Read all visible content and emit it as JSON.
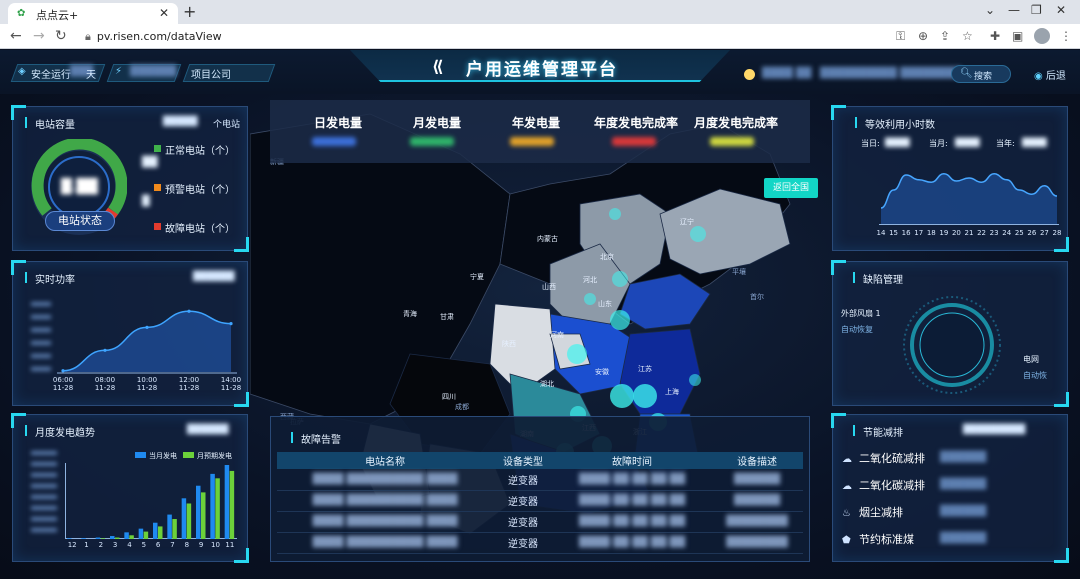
{
  "browser": {
    "tab_title": "点点云+",
    "url": "pv.risen.com/dataView"
  },
  "header": {
    "title": "户用运维管理平台",
    "safe_run_label": "安全运行",
    "safe_run_unit": "天",
    "project_label": "项目公司",
    "search_label": "搜索",
    "back_label": "后退"
  },
  "capacity": {
    "title": "电站容量",
    "unit": "个电站",
    "gauge_label": "电站状态",
    "statuses": [
      {
        "label": "正常电站（个）",
        "color": "#3fb24a"
      },
      {
        "label": "预警电站（个）",
        "color": "#f08a1c"
      },
      {
        "label": "故障电站（个）",
        "color": "#e23b2e"
      }
    ]
  },
  "realtime": {
    "title": "实时功率",
    "x_labels": [
      [
        "06:00",
        "11-28"
      ],
      [
        "08:00",
        "11-28"
      ],
      [
        "10:00",
        "11-28"
      ],
      [
        "12:00",
        "11-28"
      ],
      [
        "14:00",
        "11-28"
      ]
    ]
  },
  "monthly": {
    "title": "月度发电趋势",
    "legend": [
      {
        "label": "当月发电",
        "color": "#1f8af0"
      },
      {
        "label": "月预期发电",
        "color": "#6cd13a"
      }
    ]
  },
  "kpis": [
    "日发电量",
    "月发电量",
    "年发电量",
    "年度发电完成率",
    "月度发电完成率"
  ],
  "map": {
    "back_all_label": "返回全国",
    "provinces": [
      "内蒙古",
      "辽宁",
      "北京",
      "河北",
      "山西",
      "山东",
      "河南",
      "陕西",
      "青海",
      "甘肃",
      "宁夏",
      "四川",
      "湖北",
      "安徽",
      "江苏",
      "上海",
      "浙江",
      "江西",
      "湖南",
      "西藏",
      "新疆",
      "成都",
      "拉萨",
      "平壤",
      "首尔"
    ]
  },
  "faults": {
    "title": "故障告警",
    "columns": [
      "电站名称",
      "设备类型",
      "故障时间",
      "设备描述"
    ],
    "device_types": [
      "逆变器",
      "逆变器",
      "逆变器",
      "逆变器"
    ]
  },
  "utilization": {
    "title": "等效利用小时数",
    "labels": [
      "当日:",
      "当月:",
      "当年:"
    ],
    "x_labels": [
      "14",
      "15",
      "16",
      "17",
      "18",
      "19",
      "20",
      "21",
      "22",
      "23",
      "24",
      "25",
      "26",
      "27",
      "28"
    ]
  },
  "defects": {
    "title": "缺陷管理",
    "left_label_1": "外部风扇 1",
    "left_label_2": "自动恢复",
    "right_label_1": "电网",
    "right_label_2": "自动恢"
  },
  "savings": {
    "title": "节能减排",
    "items": [
      "二氧化硫减排",
      "二氧化碳减排",
      "烟尘减排",
      "节约标准煤"
    ]
  },
  "chart_data": [
    {
      "type": "area",
      "title": "实时功率",
      "x": [
        "06:00",
        "08:00",
        "10:00",
        "12:00",
        "14:00"
      ],
      "y": [
        0.02,
        0.35,
        0.72,
        0.98,
        0.78
      ]
    },
    {
      "type": "bar",
      "title": "月度发电趋势",
      "categories": [
        "12",
        "1",
        "2",
        "3",
        "4",
        "5",
        "6",
        "7",
        "8",
        "9",
        "10",
        "11"
      ],
      "series": [
        {
          "name": "当月发电",
          "values": [
            0.01,
            0.01,
            0.02,
            0.04,
            0.09,
            0.14,
            0.22,
            0.33,
            0.55,
            0.72,
            0.88,
            1.0
          ]
        },
        {
          "name": "月预期发电",
          "values": [
            0.0,
            0.0,
            0.01,
            0.02,
            0.05,
            0.1,
            0.17,
            0.27,
            0.48,
            0.63,
            0.82,
            0.92
          ]
        }
      ]
    },
    {
      "type": "line",
      "title": "等效利用小时数",
      "x": [
        "14",
        "15",
        "16",
        "17",
        "18",
        "19",
        "20",
        "21",
        "22",
        "23",
        "24",
        "25",
        "26",
        "27",
        "28"
      ],
      "y": [
        0.25,
        0.55,
        0.8,
        0.72,
        0.68,
        0.82,
        0.7,
        0.75,
        0.68,
        0.82,
        0.72,
        0.55,
        0.48,
        0.62,
        0.45
      ]
    }
  ]
}
